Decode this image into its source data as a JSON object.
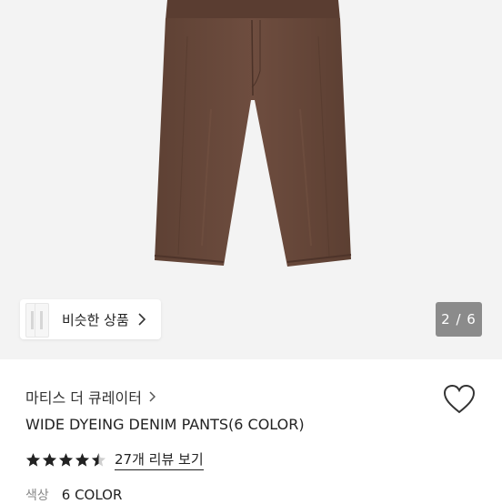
{
  "gallery": {
    "image_alt": "brown wide denim pants",
    "similar_button_label": "비슷한 상품",
    "page_current": 2,
    "page_total": 6,
    "page_counter": "2 / 6"
  },
  "product": {
    "brand": "마티스 더 큐레이터",
    "title": "WIDE DYEING DENIM PANTS(6 COLOR)",
    "rating": 4.5,
    "review_link": "27개 리뷰 보기",
    "option_label": "색상",
    "option_value": "6 COLOR"
  },
  "colors": {
    "pants": "#6a4a3c",
    "star": "#222222",
    "counter_bg": "#7a7a7a"
  },
  "icons": {
    "wish": "heart-outline-icon",
    "chevron": "chevron-right-icon",
    "star": "star-icon"
  }
}
